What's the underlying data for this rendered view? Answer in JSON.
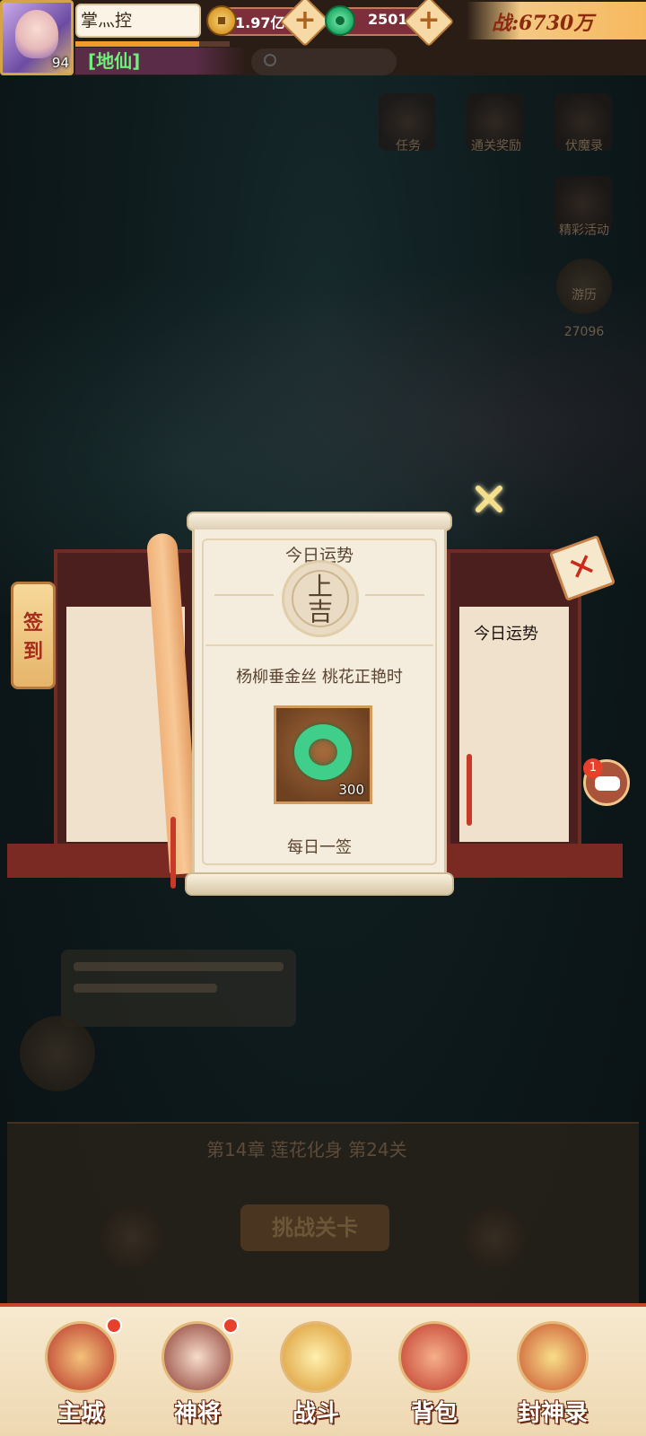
{
  "hud": {
    "player_name": "掌灬控",
    "level": "94",
    "title": "[地仙]",
    "exp_progress": 0.8,
    "coins": "1.97亿",
    "jade": "2501",
    "combat_power": "战:6730万"
  },
  "popup": {
    "title": "今日运势",
    "fortune_top": "上",
    "fortune_bottom": "吉",
    "poem": "杨柳垂金丝  桃花正艳时",
    "reward_count": "300",
    "footer": "每日一签",
    "side_tag_1": "签",
    "side_tag_2": "到",
    "side_label": "今日运势",
    "chat_badge": "1"
  },
  "background": {
    "chapter": "第14章 莲花化身 第24关",
    "challenge": "挑战关卡",
    "icon_labels": [
      "任务",
      "通关奖励",
      "伏魔录",
      "精彩活动",
      "游历"
    ],
    "travel_count": "27096"
  },
  "nav": {
    "items": [
      {
        "label": "主城",
        "icon": "city-gate-icon",
        "badge": true
      },
      {
        "label": "神将",
        "icon": "general-portrait-icon",
        "badge": true
      },
      {
        "label": "战斗",
        "icon": "crossed-swords-icon",
        "badge": false
      },
      {
        "label": "背包",
        "icon": "backpack-icon",
        "badge": false
      },
      {
        "label": "封神录",
        "icon": "dragon-scroll-icon",
        "badge": false
      }
    ]
  },
  "colors": {
    "accent": "#c8462e",
    "jade": "#3fcf8a",
    "title_green": "#6ef07a",
    "parchment": "#f4ecdc"
  }
}
